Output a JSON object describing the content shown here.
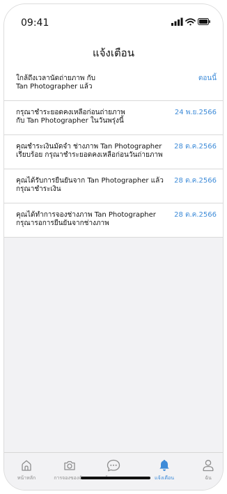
{
  "status": {
    "time": "09:41"
  },
  "header": {
    "title": "แจ้งเตือน"
  },
  "notifications": [
    {
      "message": "ใกล้ถึงเวลานัดถ่ายภาพ กับ\nTan Photographer  แล้ว",
      "date": "ตอนนี้"
    },
    {
      "message": "กรุณาชำระยอดคงเหลือก่อนถ่ายภาพ\nกับ Tan Photographer ในวันพรุ่งนี้",
      "date": "24 พ.ย.2566"
    },
    {
      "message": "คุณชำระเงินมัดจำ ช่างภาพ Tan Photographer\nเรียบร้อย กรุณาชำระยอดคงเหลือก่อนวันถ่ายภาพ",
      "date": "28 ต.ค.2566"
    },
    {
      "message": "คุณได้รับการยืนยันจาก Tan Photographer แล้ว\nกรุณาชำระเงิน",
      "date": "28 ต.ค.2566"
    },
    {
      "message": "คุณได้ทำการจองช่างภาพ Tan Photographer\nกรุณารอการยืนยันจากช่างภาพ",
      "date": "28 ต.ค.2566"
    }
  ],
  "tabbar": {
    "items": [
      {
        "label": "หน้าหลัก",
        "icon": "home-icon"
      },
      {
        "label": "การจองของฉัน",
        "icon": "camera-icon"
      },
      {
        "label": "ข้อความ",
        "icon": "chat-icon"
      },
      {
        "label": "แจ้งเตือน",
        "icon": "bell-icon"
      },
      {
        "label": "ฉัน",
        "icon": "user-icon"
      }
    ],
    "active_index": 3
  },
  "colors": {
    "accent": "#3d8bd8",
    "background": "#f2f2f4",
    "inactive": "#8d8d8d"
  }
}
